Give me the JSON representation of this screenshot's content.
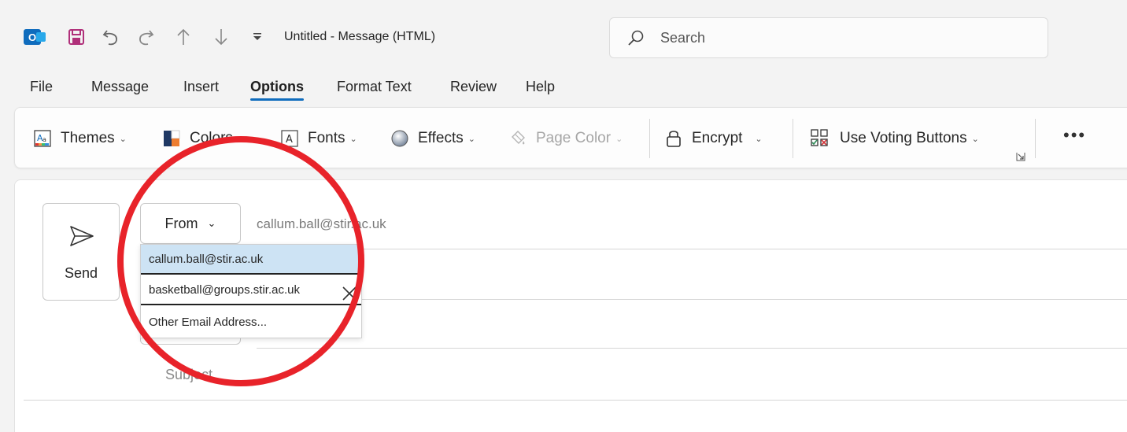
{
  "titlebar": {
    "doc_title": "Untitled  -  Message (HTML)",
    "icons": [
      "outlook-app-icon",
      "save-icon",
      "undo-icon",
      "redo-icon",
      "up-arrow-icon",
      "down-arrow-icon",
      "customize-quick-access-icon"
    ]
  },
  "search": {
    "placeholder": "Search"
  },
  "tabs": [
    {
      "label": "File"
    },
    {
      "label": "Message"
    },
    {
      "label": "Insert"
    },
    {
      "label": "Options",
      "active": true
    },
    {
      "label": "Format Text"
    },
    {
      "label": "Review"
    },
    {
      "label": "Help"
    }
  ],
  "ribbon": {
    "themes": "Themes",
    "colors": "Colors",
    "fonts": "Fonts",
    "effects": "Effects",
    "page_color": "Page Color",
    "encrypt": "Encrypt",
    "voting": "Use Voting Buttons",
    "more": "•••"
  },
  "compose": {
    "send_label": "Send",
    "from_label": "From",
    "from_value": "callum.ball@stir.ac.uk",
    "subject_label": "Subject"
  },
  "dropdown": {
    "items": [
      {
        "label": "callum.ball@stir.ac.uk",
        "selected": true
      },
      {
        "label": "basketball@groups.stir.ac.uk"
      },
      {
        "label": "Other Email Address..."
      }
    ]
  },
  "colors": {
    "accent": "#0f6cbd",
    "annotation": "#e8232a",
    "selected_bg": "#cde3f4"
  }
}
